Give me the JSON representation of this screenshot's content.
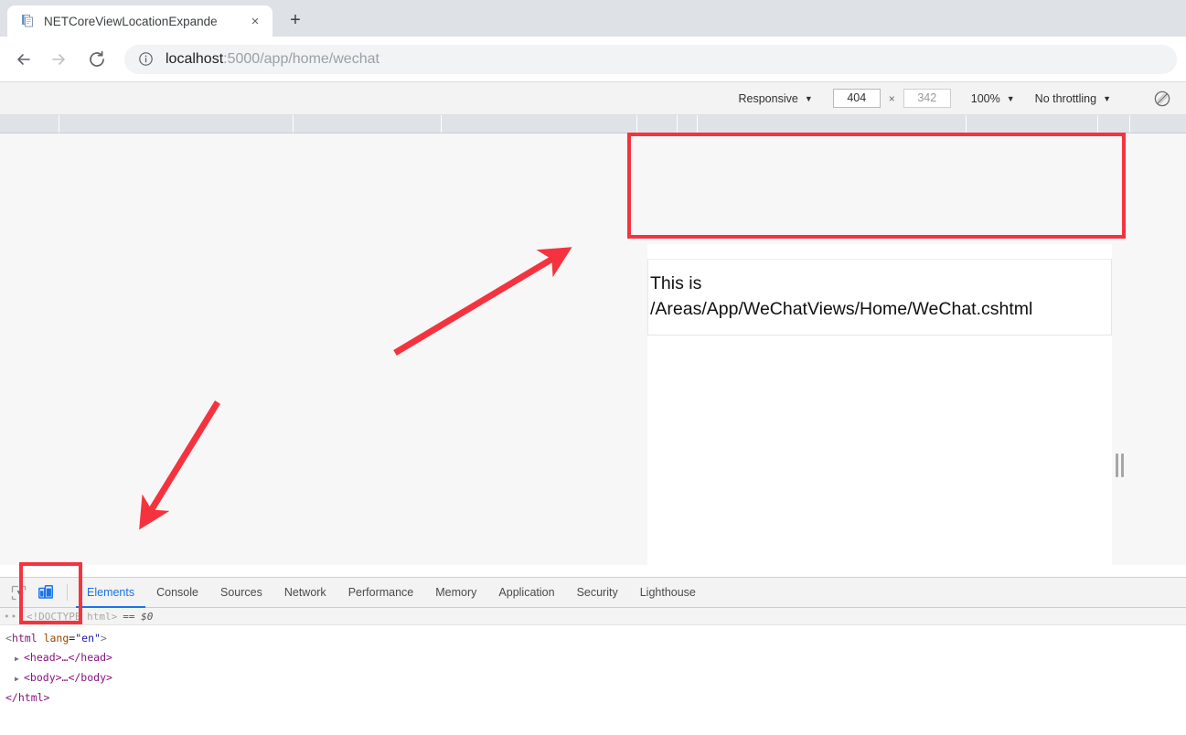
{
  "browser": {
    "tab": {
      "title": "NETCoreViewLocationExpande",
      "favicon": "page-icon",
      "close_label": "×"
    },
    "new_tab_label": "+",
    "nav": {
      "back": "←",
      "forward": "→",
      "reload": "⟳"
    },
    "omnibox": {
      "info_icon": "info-circle-icon",
      "host": "localhost",
      "path": ":5000/app/home/wechat"
    }
  },
  "device_toolbar": {
    "device": "Responsive",
    "caret": "▼",
    "width": "404",
    "height": "342",
    "height_is_placeholder": true,
    "x_label": "×",
    "zoom": "100%",
    "throttling": "No throttling",
    "rotate_icon": "rotate-icon"
  },
  "viewport": {
    "page_text": "This is\n/Areas/App/WeChatViews/Home/WeChat.cshtml"
  },
  "devtools": {
    "inspect_icon": "inspect-element-icon",
    "device_toggle_icon": "device-toolbar-icon",
    "tabs": [
      {
        "label": "Elements",
        "active": true
      },
      {
        "label": "Console",
        "active": false
      },
      {
        "label": "Sources",
        "active": false
      },
      {
        "label": "Network",
        "active": false
      },
      {
        "label": "Performance",
        "active": false
      },
      {
        "label": "Memory",
        "active": false
      },
      {
        "label": "Application",
        "active": false
      },
      {
        "label": "Security",
        "active": false
      },
      {
        "label": "Lighthouse",
        "active": false
      }
    ],
    "breadcrumb": {
      "dots": "•••",
      "node": "<!DOCTYPE html>",
      "selection": "== $0"
    },
    "dom": {
      "line1_open": "<",
      "line1_tag": "html",
      "line1_attr": "lang",
      "line1_value": "\"en\"",
      "line1_close": ">",
      "line2": "<head>…</head>",
      "line3": "<body>…</body>",
      "line4": "</html>",
      "triangle": "▶"
    }
  },
  "annotations": {
    "accent_color": "#f5333f",
    "highlight_viewport_label": "viewport-content-highlight",
    "highlight_device_toggle_label": "device-toggle-highlight",
    "arrow_to_viewport": "arrow-pointing-to-rendered-view",
    "arrow_to_device_toggle": "arrow-pointing-to-device-toolbar-button"
  }
}
